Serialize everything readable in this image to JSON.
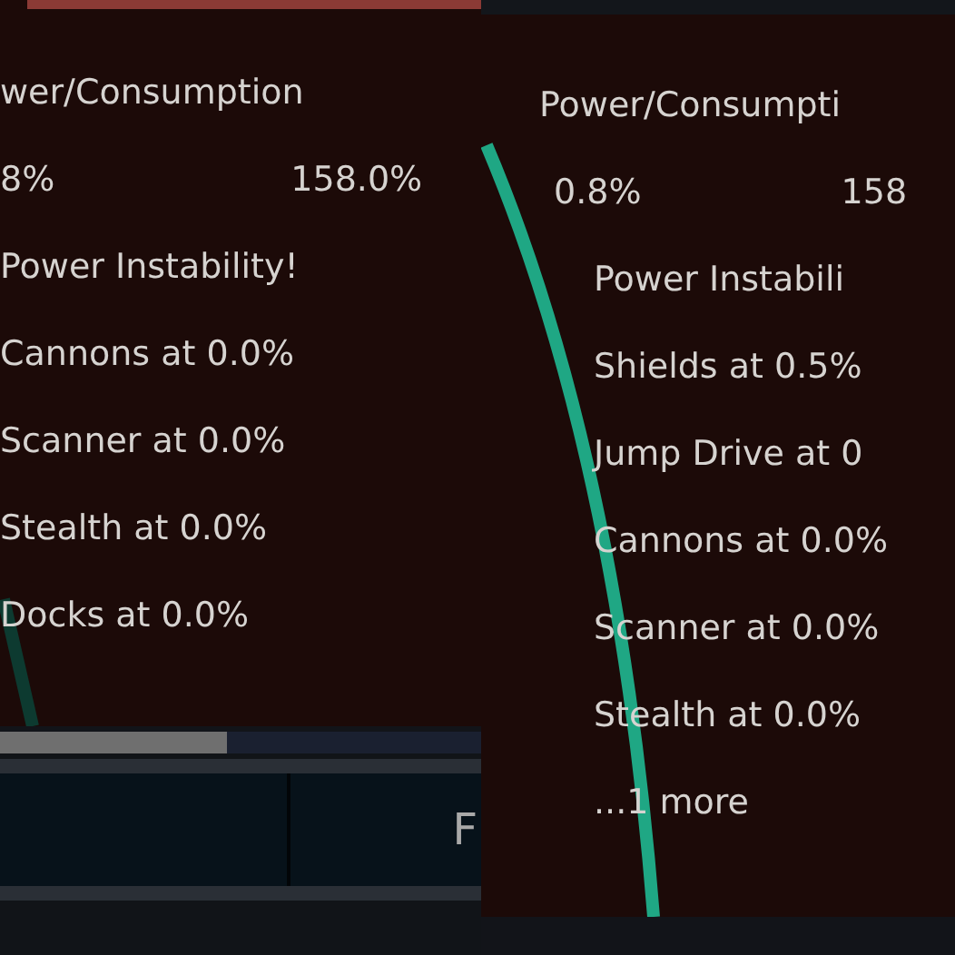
{
  "left_tooltip": {
    "header": "wer/Consumption",
    "power": "8%",
    "consumption": "158.0%",
    "warning": "Power Instability!",
    "lines": [
      "Cannons at 0.0%",
      "Scanner at 0.0%",
      "Stealth at 0.0%",
      "Docks at 0.0%"
    ]
  },
  "left_footer": {
    "progress": {
      "level": 0.47
    },
    "button_label": "F"
  },
  "right_tooltip": {
    "header": "Power/Consumpti",
    "power": "0.8%",
    "consumption": "158",
    "warning": "Power Instabili",
    "lines": [
      "Shields at 0.5%",
      "Jump Drive at 0",
      "Cannons at 0.0%",
      "Scanner at 0.0%",
      "Stealth at 0.0%"
    ],
    "more": "...1 more"
  }
}
